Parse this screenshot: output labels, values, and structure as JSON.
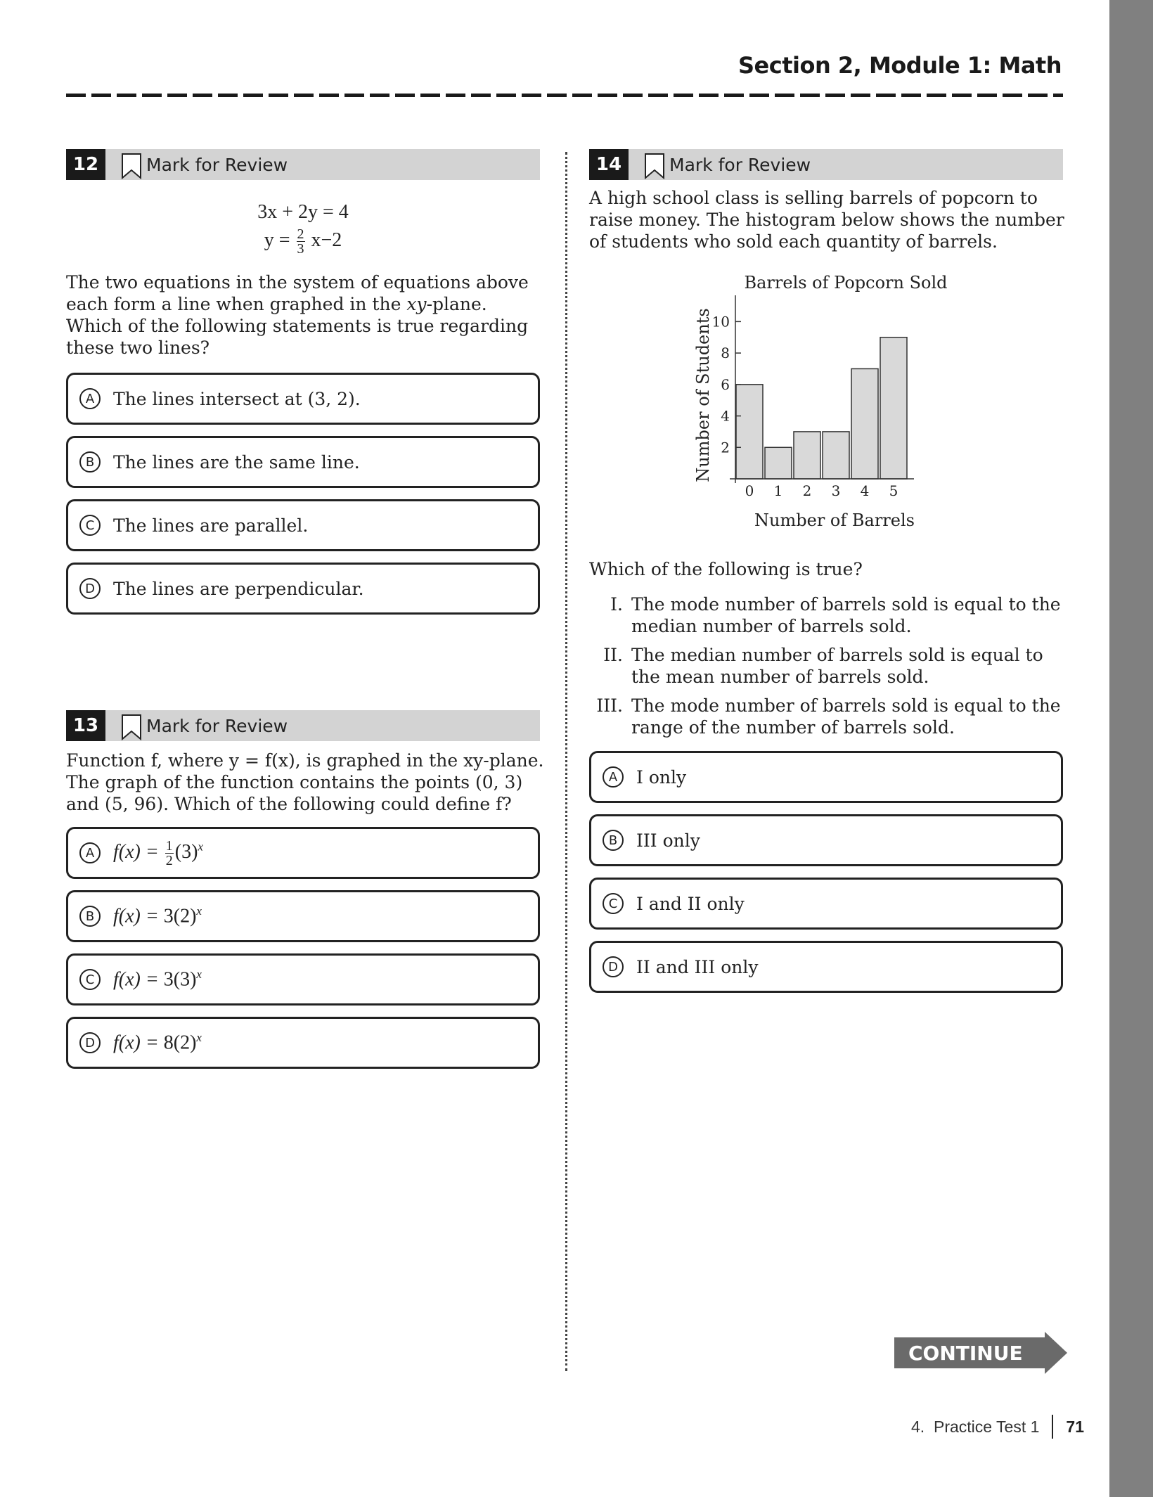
{
  "header": {
    "section_title": "Section 2, Module 1: Math"
  },
  "questions": {
    "q12": {
      "number": "12",
      "mark_label": "Mark for Review",
      "eq1": "3x + 2y = 4",
      "eq2_left": "y =",
      "eq2_frac_num": "2",
      "eq2_frac_den": "3",
      "eq2_right": "x−2",
      "prompt_a": "The two equations in the system of equations above each form a line when graphed in the ",
      "prompt_var": "xy",
      "prompt_b": "-plane. Which of the following statements is true regarding these two lines?",
      "choices": [
        {
          "letter": "A",
          "text": "The lines intersect at (3, 2)."
        },
        {
          "letter": "B",
          "text": "The lines are the same line."
        },
        {
          "letter": "C",
          "text": "The lines are parallel."
        },
        {
          "letter": "D",
          "text": "The lines are perpendicular."
        }
      ]
    },
    "q13": {
      "number": "13",
      "mark_label": "Mark for Review",
      "prompt": "Function f, where y = f(x), is graphed in the xy-plane. The graph of the function contains the points (0, 3) and (5, 96). Which of the following could define f?",
      "choices": [
        {
          "letter": "A",
          "lhs": "f(x) =",
          "frac_num": "1",
          "frac_den": "2",
          "base": "(3)",
          "exp": "x"
        },
        {
          "letter": "B",
          "lhs": "f(x) =",
          "base": "3(2)",
          "exp": "x"
        },
        {
          "letter": "C",
          "lhs": "f(x) =",
          "base": "3(3)",
          "exp": "x"
        },
        {
          "letter": "D",
          "lhs": "f(x) =",
          "base": "8(2)",
          "exp": "x"
        }
      ]
    },
    "q14": {
      "number": "14",
      "mark_label": "Mark for Review",
      "intro": "A high school class is selling barrels of popcorn to raise money. The histogram below shows the number of students who sold each quantity of barrels.",
      "question": "Which of the following is true?",
      "statements": [
        {
          "num": "I.",
          "text": "The mode number of barrels sold is equal to the median number of barrels sold."
        },
        {
          "num": "II.",
          "text": "The median number of barrels sold is equal to the mean number of barrels sold."
        },
        {
          "num": "III.",
          "text": "The mode number of barrels sold is equal to the range of the number of barrels sold."
        }
      ],
      "choices": [
        {
          "letter": "A",
          "text": "I only"
        },
        {
          "letter": "B",
          "text": "III only"
        },
        {
          "letter": "C",
          "text": "I and II only"
        },
        {
          "letter": "D",
          "text": "II and III only"
        }
      ]
    }
  },
  "chart_data": {
    "type": "bar",
    "title": "Barrels of Popcorn Sold",
    "xlabel": "Number of Barrels",
    "ylabel": "Number of Students",
    "categories": [
      "0",
      "1",
      "2",
      "3",
      "4",
      "5"
    ],
    "values": [
      6,
      2,
      3,
      3,
      7,
      9
    ],
    "yticks": [
      2,
      4,
      6,
      8,
      10
    ],
    "ylim": [
      0,
      11
    ],
    "grid": false,
    "bar_color": "#d9d9d9"
  },
  "navigation": {
    "continue_label": "CONTINUE"
  },
  "footer": {
    "chapter": "4.  Practice Test 1",
    "page_number": "71"
  }
}
